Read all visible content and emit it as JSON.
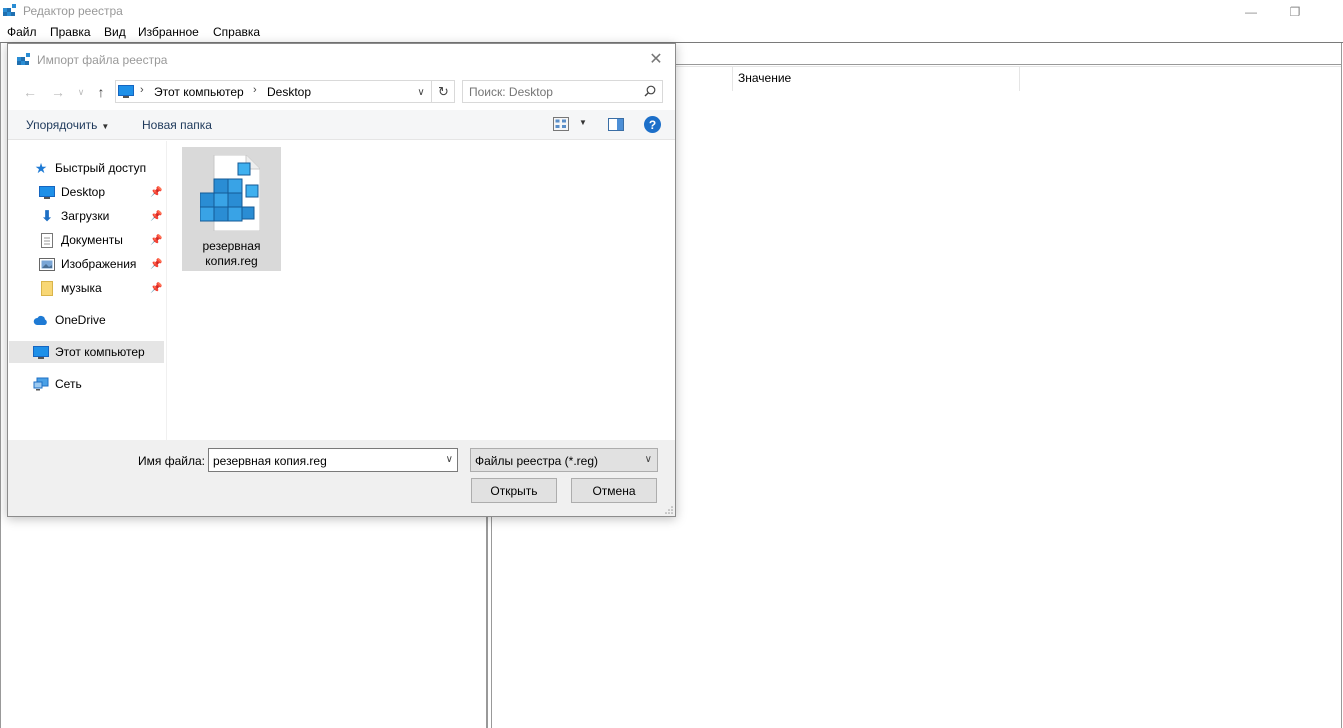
{
  "main_window": {
    "title": "Редактор реестра",
    "menu": [
      "Файл",
      "Правка",
      "Вид",
      "Избранное",
      "Справка"
    ],
    "columns": {
      "value": "Значение"
    }
  },
  "dialog": {
    "title": "Импорт файла реестра",
    "breadcrumb": [
      "Этот компьютер",
      "Desktop"
    ],
    "search_placeholder": "Поиск: Desktop",
    "toolbar": {
      "organize": "Упорядочить",
      "new_folder": "Новая папка"
    },
    "nav": {
      "quick_access": "Быстрый доступ",
      "items": [
        "Desktop",
        "Загрузки",
        "Документы",
        "Изображения",
        "музыка"
      ],
      "onedrive": "OneDrive",
      "this_pc": "Этот компьютер",
      "network": "Сеть"
    },
    "files": [
      {
        "name_line1": "резервная",
        "name_line2": "копия.reg",
        "icon": "registry-file-icon"
      }
    ],
    "filename_label": "Имя файла:",
    "filename_value": "резервная копия.reg",
    "filter": "Файлы реестра (*.reg)",
    "open_button": "Открыть",
    "cancel_button": "Отмена"
  },
  "colors": {
    "accent": "#1c6fc9",
    "selected": "#d9d9d9",
    "footer_bg": "#f0f0f0"
  }
}
